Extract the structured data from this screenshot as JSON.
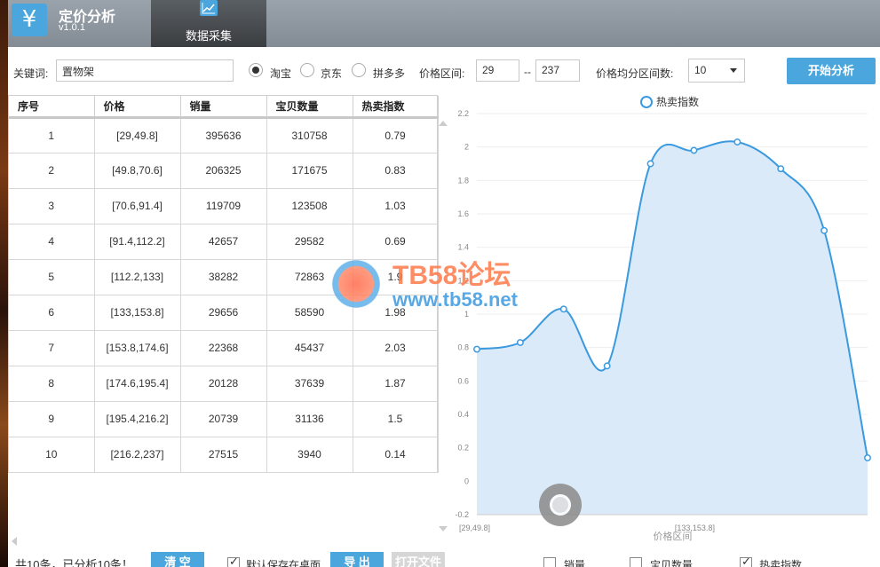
{
  "app": {
    "logo": "¥",
    "title": "定价分析",
    "version": "v1.0.1"
  },
  "tabs": [
    {
      "label": "数据采集",
      "icon": "line-chart-icon"
    }
  ],
  "toolbar": {
    "keyword_label": "关键词:",
    "keyword_value": "置物架",
    "platforms": [
      {
        "label": "淘宝",
        "selected": true
      },
      {
        "label": "京东",
        "selected": false
      },
      {
        "label": "拼多多",
        "selected": false
      }
    ],
    "price_range_label": "价格区间:",
    "price_min": "29",
    "price_sep": "--",
    "price_max": "237",
    "intervals_label": "价格均分区间数:",
    "intervals_value": "10",
    "start_button": "开始分析"
  },
  "table": {
    "columns": [
      "序号",
      "价格",
      "销量",
      "宝贝数量",
      "热卖指数"
    ],
    "rows": [
      [
        "1",
        "[29,49.8]",
        "395636",
        "310758",
        "0.79"
      ],
      [
        "2",
        "[49.8,70.6]",
        "206325",
        "171675",
        "0.83"
      ],
      [
        "3",
        "[70.6,91.4]",
        "119709",
        "123508",
        "1.03"
      ],
      [
        "4",
        "[91.4,112.2]",
        "42657",
        "29582",
        "0.69"
      ],
      [
        "5",
        "[112.2,133]",
        "38282",
        "72863",
        "1.9"
      ],
      [
        "6",
        "[133,153.8]",
        "29656",
        "58590",
        "1.98"
      ],
      [
        "7",
        "[153.8,174.6]",
        "22368",
        "45437",
        "2.03"
      ],
      [
        "8",
        "[174.6,195.4]",
        "20128",
        "37639",
        "1.87"
      ],
      [
        "9",
        "[195.4,216.2]",
        "20739",
        "31136",
        "1.5"
      ],
      [
        "10",
        "[216.2,237]",
        "27515",
        "3940",
        "0.14"
      ]
    ]
  },
  "chart_data": {
    "type": "area",
    "legend": "热卖指数",
    "legend_position": "top",
    "series": [
      {
        "name": "热卖指数",
        "values": [
          0.79,
          0.83,
          1.03,
          0.69,
          1.9,
          1.98,
          2.03,
          1.87,
          1.5,
          0.14
        ]
      }
    ],
    "categories": [
      "[29,49.8]",
      "[49.8,70.6]",
      "[70.6,91.4]",
      "[91.4,112.2]",
      "[112.2,133]",
      "[133,153.8]",
      "[153.8,174.6]",
      "[174.6,195.4]",
      "[195.4,216.2]",
      "[216.2,237]"
    ],
    "x_tick_labels": [
      "[29,49.8]",
      "[133,153.8]"
    ],
    "xlabel": "价格区间",
    "ylim": [
      -0.2,
      2.2
    ],
    "yticks": [
      "-0.2",
      "0",
      "0.2",
      "0.4",
      "0.6",
      "0.8",
      "1",
      "1.2",
      "1.4",
      "1.6",
      "1.8",
      "2",
      "2.2"
    ],
    "grid": true,
    "line_color": "#3a9ae0",
    "fill_color": "#dbeaf8"
  },
  "watermark": {
    "line1": "TB58论坛",
    "line2": "www.tb58.net"
  },
  "bottom": {
    "summary": "共10条，已分析10条！",
    "clear_button": "清 空",
    "save_desktop_label": "默认保存在桌面",
    "save_desktop_checked": true,
    "export_button": "导 出",
    "open_file_button": "打开文件",
    "series_toggles": [
      {
        "label": "销量",
        "checked": false
      },
      {
        "label": "宝贝数量",
        "checked": false
      },
      {
        "label": "热卖指数",
        "checked": true
      }
    ]
  },
  "colors": {
    "accent": "#4aa6dc",
    "header": "#8c959e"
  }
}
